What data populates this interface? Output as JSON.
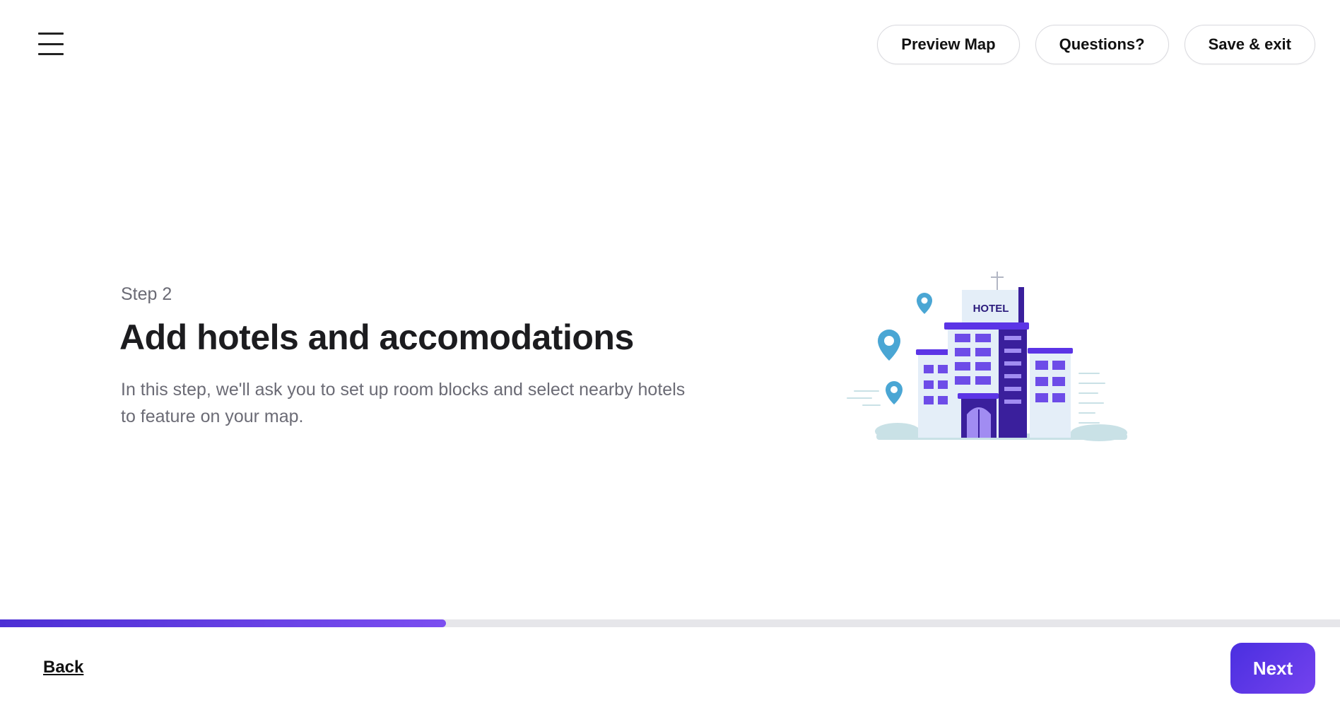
{
  "header": {
    "menu_icon": "hamburger-menu-icon",
    "actions": [
      {
        "label": "Preview Map"
      },
      {
        "label": "Questions?"
      },
      {
        "label": "Save & exit"
      }
    ]
  },
  "main": {
    "step_label": "Step 2",
    "title": "Add hotels and accomodations",
    "description": "In this step, we'll ask you to set up room blocks and select nearby hotels to feature on your map.",
    "illustration": {
      "name": "hotel-illustration",
      "sign_text": "HOTEL"
    }
  },
  "progress": {
    "fraction": 0.333
  },
  "footer": {
    "back_label": "Back",
    "next_label": "Next"
  },
  "colors": {
    "accent": "#5b34e6",
    "accent_dark": "#3a1f9c",
    "building_light": "#e4eef8",
    "pin": "#4aa6d4"
  }
}
